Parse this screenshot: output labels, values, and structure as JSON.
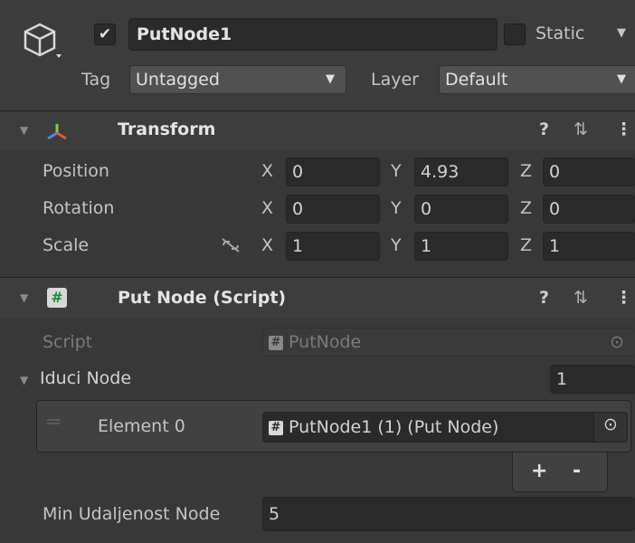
{
  "header": {
    "enabled_mark": "✔",
    "object_name": "PutNode1",
    "static_label": "Static",
    "tag_label": "Tag",
    "tag_value": "Untagged",
    "layer_label": "Layer",
    "layer_value": "Default"
  },
  "transform": {
    "title": "Transform",
    "rows": [
      {
        "label": "Position",
        "x": "0",
        "y": "4.93",
        "z": "0"
      },
      {
        "label": "Rotation",
        "x": "0",
        "y": "0",
        "z": "0"
      },
      {
        "label": "Scale",
        "x": "1",
        "y": "1",
        "z": "1"
      }
    ],
    "axis_x": "X",
    "axis_y": "Y",
    "axis_z": "Z"
  },
  "put_node": {
    "title": "Put Node (Script)",
    "script_label": "Script",
    "script_value": "PutNode",
    "list_label": "Iduci Node",
    "list_count": "1",
    "element_label": "Element 0",
    "element_value": "PutNode1 (1) (Put Node)",
    "add_label": "+",
    "remove_label": "-",
    "min_label": "Min Udaljenost Node",
    "min_value": "5"
  },
  "icons": {
    "help": "?",
    "presets": "⇅",
    "menu": "⋮",
    "foldout": "▼",
    "dropdown": "▼",
    "target": "⊙"
  }
}
